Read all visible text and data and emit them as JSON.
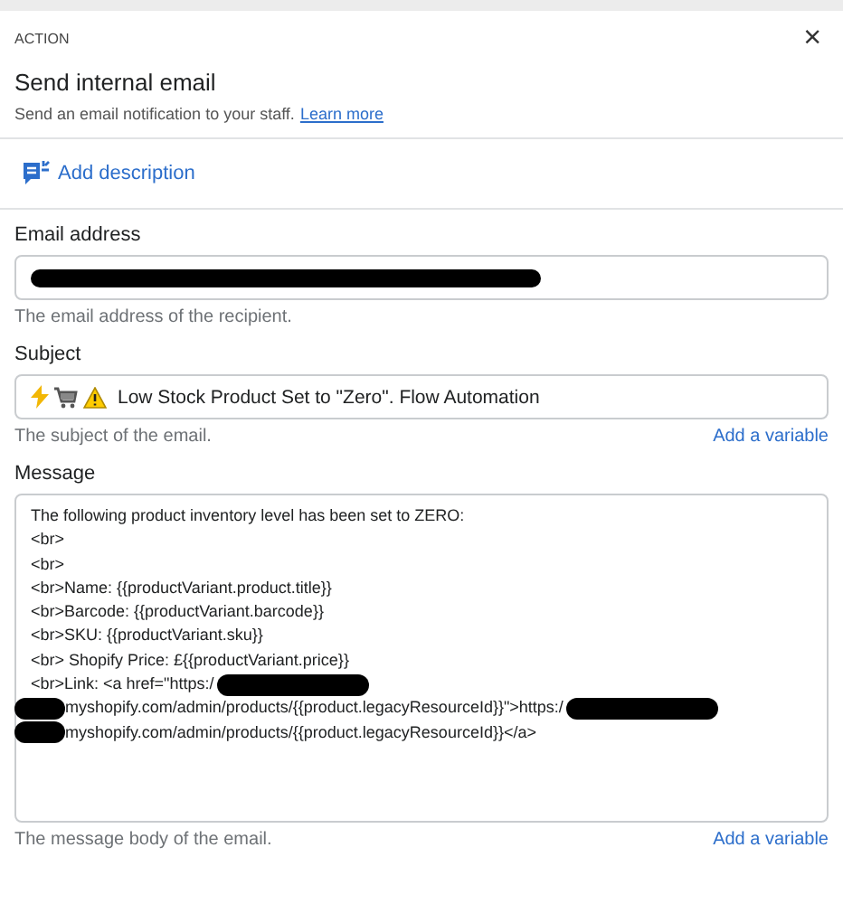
{
  "header": {
    "eyebrow": "ACTION",
    "close": "×",
    "title": "Send internal email",
    "subtitle": "Send an email notification to your staff.",
    "link": "Learn more"
  },
  "add_description": "Add description",
  "email": {
    "label": "Email address",
    "redacted": true,
    "help": "The email address of the recipient."
  },
  "subject": {
    "label": "Subject",
    "value": "Low Stock Product Set to \"Zero\". Flow Automation",
    "help": "The subject of the email.",
    "action": "Add a variable"
  },
  "message": {
    "label": "Message",
    "lines": [
      [
        {
          "kind": "text",
          "text": "The following product inventory level has been set to ZERO:"
        }
      ],
      [
        {
          "kind": "text",
          "text": "<br>"
        }
      ],
      [
        {
          "kind": "text",
          "text": "<br>"
        }
      ],
      [
        {
          "kind": "text",
          "text": "<br>Name: {{productVariant.product.title}}"
        }
      ],
      [
        {
          "kind": "text",
          "text": "<br>Barcode: {{productVariant.barcode}}"
        }
      ],
      [
        {
          "kind": "text",
          "text": "<br>SKU: {{productVariant.sku}}"
        }
      ],
      [
        {
          "kind": "text",
          "text": "<br> Shopify Price: £{{productVariant.price}}"
        }
      ],
      [
        {
          "kind": "text",
          "text": "<br>Link: <a href=\"https:/"
        },
        {
          "kind": "redaction"
        }
      ],
      [
        {
          "kind": "redaction"
        },
        {
          "kind": "text",
          "text": "myshopify.com/admin/products/{{product.legacyResourceId}}\">https:/"
        },
        {
          "kind": "redaction"
        }
      ],
      [
        {
          "kind": "redaction"
        },
        {
          "kind": "text",
          "text": "myshopify.com/admin/products/{{product.legacyResourceId}}</a>"
        }
      ]
    ],
    "help": "The message body of the email.",
    "action": "Add a variable"
  }
}
